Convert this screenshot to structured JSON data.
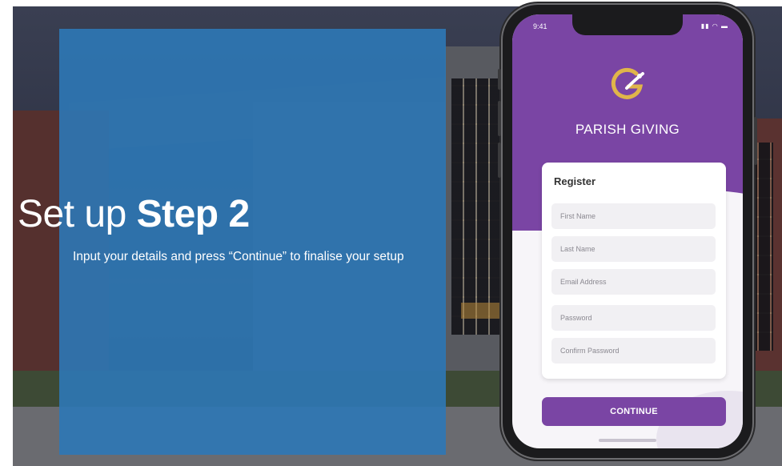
{
  "slide": {
    "title_prefix": "Set up ",
    "title_bold": "Step 2",
    "subtitle": "Input your details and press “Continue” to finalise your setup"
  },
  "phone": {
    "status_time": "9:41",
    "status_icons": "signal-wifi-battery-icon",
    "brand": "PARISH GIVING",
    "logo": "parish-giving-logo-icon",
    "form": {
      "title": "Register",
      "fields": [
        {
          "placeholder": "First Name"
        },
        {
          "placeholder": "Last Name"
        },
        {
          "placeholder": "Email Address"
        },
        {
          "placeholder": "Password"
        },
        {
          "placeholder": "Confirm Password"
        }
      ],
      "continue_label": "CONTINUE"
    }
  },
  "colors": {
    "panel_blue": "#2e78b6",
    "brand_purple": "#7a45a4",
    "logo_gold": "#e0b54a"
  }
}
